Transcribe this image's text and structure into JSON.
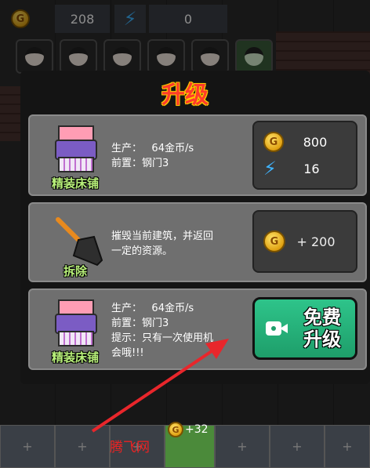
{
  "hud": {
    "coins": "208",
    "energy": "0",
    "coin_glyph": "G"
  },
  "title": "升级",
  "upgrade_card": {
    "name": "精装床铺",
    "production_label": "生产：",
    "production_value": "64金币/s",
    "prereq_label": "前置：",
    "prereq_value": "钢门3",
    "cost_coins": "800",
    "cost_energy": "16"
  },
  "demolish_card": {
    "name": "拆除",
    "desc_line1": "摧毁当前建筑，并返回",
    "desc_line2": "一定的资源。",
    "refund": "+ 200"
  },
  "free_card": {
    "name": "精装床铺",
    "production_label": "生产：",
    "production_value": "64金币/s",
    "prereq_label": "前置：",
    "prereq_value": "钢门3",
    "hint_line1": "提示：只有一次使用机",
    "hint_line2": "会哦!!!",
    "button_line1": "免费",
    "button_line2": "升级"
  },
  "bottom": {
    "gain": "+32",
    "slot_plus": "+"
  },
  "watermark": "腾飞网",
  "colors": {
    "title": "#ff3b2a",
    "free_button": "#2ec48a",
    "arrow": "#e8262b"
  }
}
